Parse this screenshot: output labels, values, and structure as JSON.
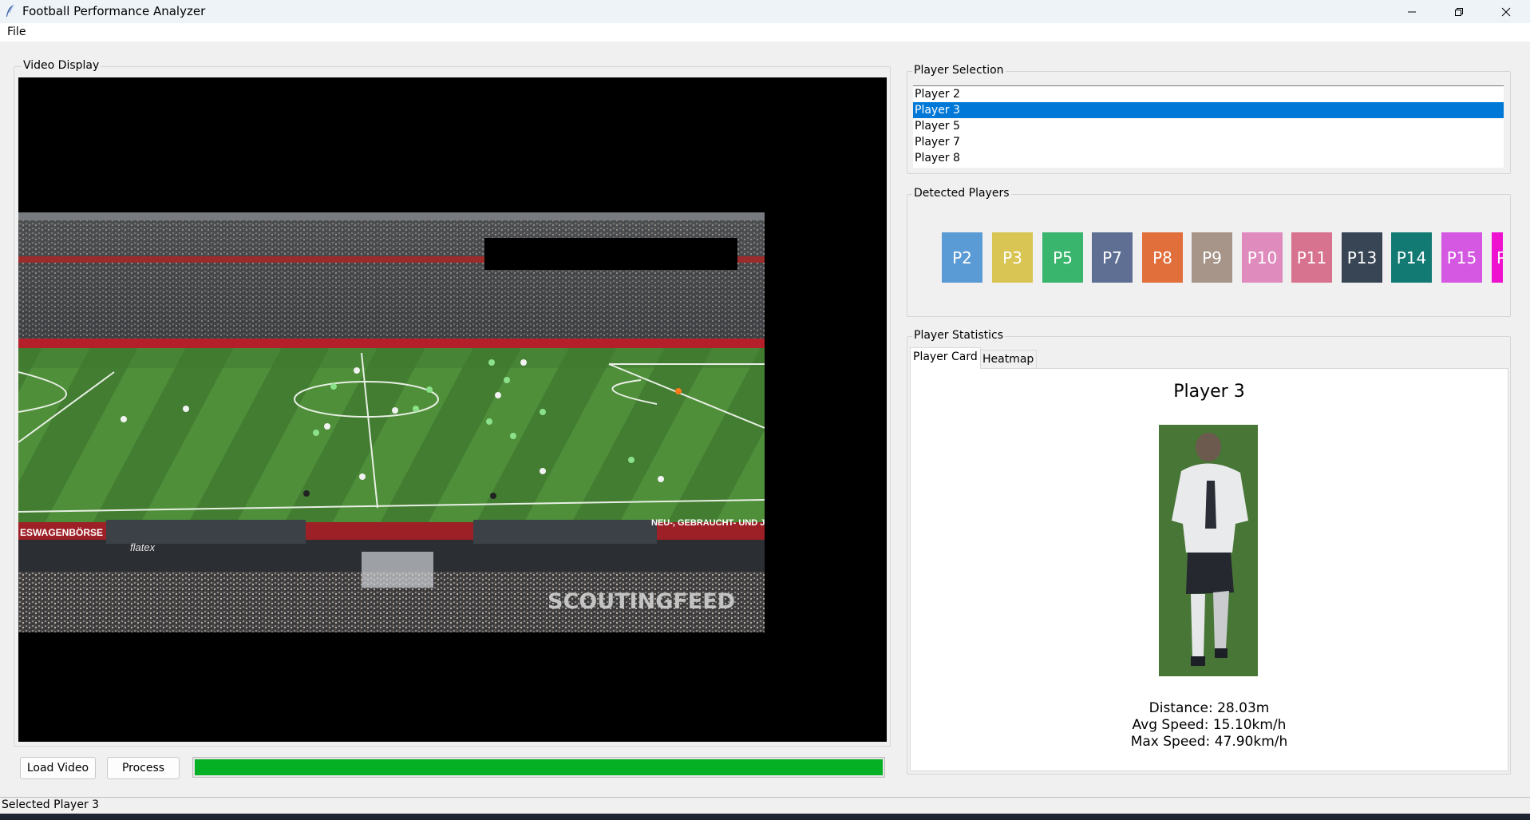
{
  "window": {
    "title": "Football Performance Analyzer",
    "controls": [
      "minimize-icon",
      "restore-icon",
      "close-icon"
    ]
  },
  "menu": {
    "file": "File"
  },
  "video_panel": {
    "label": "Video Display",
    "watermark": "SCOUTINGFEED",
    "banner_texts": [
      "ESWAGENBÖRSE",
      "NEU-, GEBRAUCHT- UND JA",
      "flatex"
    ]
  },
  "controls": {
    "load_video": "Load Video",
    "process": "Process",
    "progress_percent": 100,
    "progress_color": "#06b025"
  },
  "player_selection": {
    "label": "Player Selection",
    "items": [
      "Player 2",
      "Player 3",
      "Player 5",
      "Player 7",
      "Player 8"
    ],
    "selected": "Player 3"
  },
  "detected_players": {
    "label": "Detected Players",
    "chips": [
      {
        "label": "P2",
        "color": "#5b9bd5"
      },
      {
        "label": "P3",
        "color": "#d9c553"
      },
      {
        "label": "P5",
        "color": "#39b56e"
      },
      {
        "label": "P7",
        "color": "#5f6f94"
      },
      {
        "label": "P8",
        "color": "#e16f3c"
      },
      {
        "label": "P9",
        "color": "#a69588"
      },
      {
        "label": "P10",
        "color": "#e08bbd"
      },
      {
        "label": "P11",
        "color": "#d8738f"
      },
      {
        "label": "P13",
        "color": "#374554"
      },
      {
        "label": "P14",
        "color": "#127a73"
      },
      {
        "label": "P15",
        "color": "#d558e2"
      },
      {
        "label": "P",
        "color": "#ee11d0"
      }
    ]
  },
  "statistics": {
    "label": "Player Statistics",
    "tabs": [
      "Player Card",
      "Heatmap"
    ],
    "active_tab": "Player Card",
    "card": {
      "player_name": "Player 3",
      "distance": "Distance: 28.03m",
      "avg_speed": "Avg Speed: 15.10km/h",
      "max_speed": "Max Speed: 47.90km/h"
    }
  },
  "status": "Selected Player 3"
}
